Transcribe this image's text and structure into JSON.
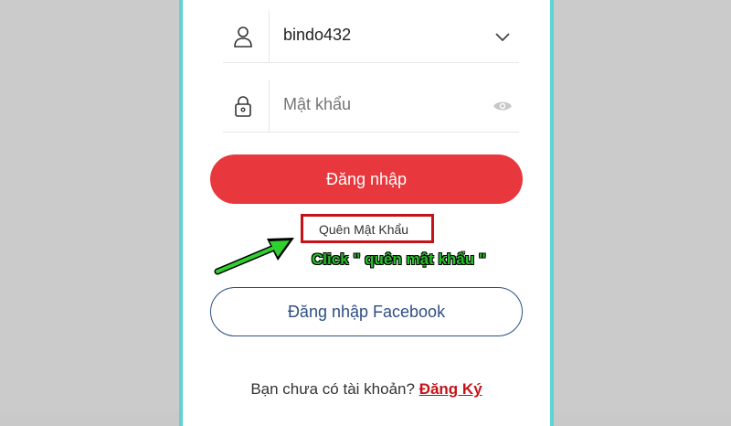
{
  "login_form": {
    "username_value": "bindo432",
    "password_placeholder": "Mật khẩu",
    "login_button": "Đăng nhập",
    "forgot_password": "Quên Mật Khẩu",
    "facebook_button": "Đăng nhập Facebook",
    "signup_prompt": "Bạn chưa có tài khoản?",
    "signup_link": "Đăng Ký"
  },
  "annotation": {
    "text": "Click \" quên mật khẩu \""
  },
  "icons": {
    "user": "user-icon",
    "lock": "lock-icon",
    "chevron": "chevron-down-icon",
    "eye": "eye-icon",
    "arrow": "arrow-icon"
  },
  "colors": {
    "primary_red": "#e8383d",
    "highlight_red": "#c4141a",
    "facebook_blue": "#2e4f85",
    "frame_teal": "#5fd3d3",
    "annotation_green": "#25c02a"
  }
}
